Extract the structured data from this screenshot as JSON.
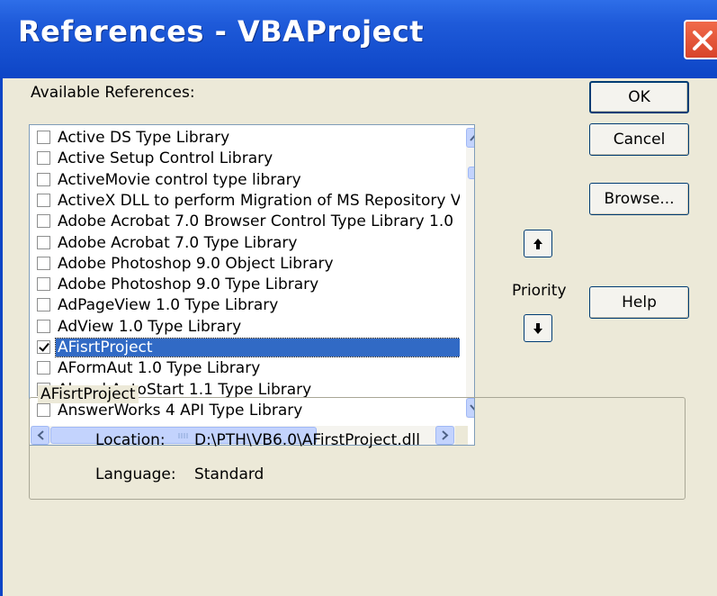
{
  "window": {
    "title": "References - VBAProject"
  },
  "available_label": "Available References:",
  "references": [
    {
      "label": "Active DS Type Library",
      "checked": false,
      "selected": false
    },
    {
      "label": "Active Setup Control Library",
      "checked": false,
      "selected": false
    },
    {
      "label": "ActiveMovie control type library",
      "checked": false,
      "selected": false
    },
    {
      "label": "ActiveX DLL to perform Migration of MS Repository V",
      "checked": false,
      "selected": false
    },
    {
      "label": "Adobe Acrobat 7.0 Browser Control Type Library 1.0",
      "checked": false,
      "selected": false
    },
    {
      "label": "Adobe Acrobat 7.0 Type Library",
      "checked": false,
      "selected": false
    },
    {
      "label": "Adobe Photoshop 9.0 Object Library",
      "checked": false,
      "selected": false
    },
    {
      "label": "Adobe Photoshop 9.0 Type Library",
      "checked": false,
      "selected": false
    },
    {
      "label": "AdPageView 1.0 Type Library",
      "checked": false,
      "selected": false
    },
    {
      "label": "AdView 1.0 Type Library",
      "checked": false,
      "selected": false
    },
    {
      "label": "AFisrtProject",
      "checked": true,
      "selected": true
    },
    {
      "label": "AFormAut 1.0 Type Library",
      "checked": false,
      "selected": false
    },
    {
      "label": "Ahead AutoStart 1.1 Type Library",
      "checked": false,
      "selected": false
    },
    {
      "label": "AnswerWorks 4 API Type Library",
      "checked": false,
      "selected": false
    }
  ],
  "buttons": {
    "ok": "OK",
    "cancel": "Cancel",
    "browse": "Browse...",
    "help": "Help"
  },
  "priority_label": "Priority",
  "details": {
    "title": "AFisrtProject",
    "location_label": "Location:",
    "location_value": "D:\\PTH\\VB6.0\\AFirstProject.dll",
    "language_label": "Language:",
    "language_value": "Standard"
  },
  "icons": {
    "close": "close-icon",
    "scroll_up": "chevron-up-icon",
    "scroll_down": "chevron-down-icon",
    "scroll_left": "chevron-left-icon",
    "scroll_right": "chevron-right-icon",
    "priority_up": "arrow-up-icon",
    "priority_down": "arrow-down-icon"
  }
}
